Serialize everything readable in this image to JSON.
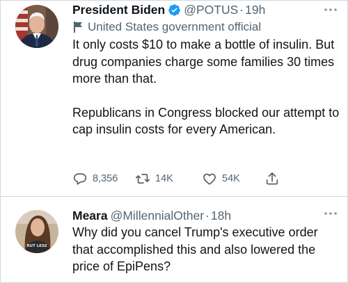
{
  "main_tweet": {
    "name": "President Biden",
    "handle": "@POTUS",
    "separator": "·",
    "time": "19h",
    "label": "United States government official",
    "paragraphs": [
      "It only costs $10 to make a bottle of insulin. But drug companies charge some families 30 times more than that.",
      "Republicans in Congress blocked our attempt to cap insulin costs for every American."
    ],
    "reply_count": "8,356",
    "retweet_count": "14K",
    "like_count": "54K"
  },
  "reply_tweet": {
    "name": "Meara",
    "handle": "@MillennialOther",
    "separator": "·",
    "time": "18h",
    "text": "Why did you cancel Trump's executive order that accomplished this and also lowered the price of EpiPens?",
    "avatar_shirt_text": "RUT LESS"
  },
  "colors": {
    "verified_blue": "#1d9bf0",
    "secondary_text": "#536471",
    "divider": "#cfd9de"
  },
  "icons": [
    "verified-badge-icon",
    "more-icon",
    "government-flag-icon",
    "reply-icon",
    "retweet-icon",
    "like-icon",
    "share-icon"
  ]
}
